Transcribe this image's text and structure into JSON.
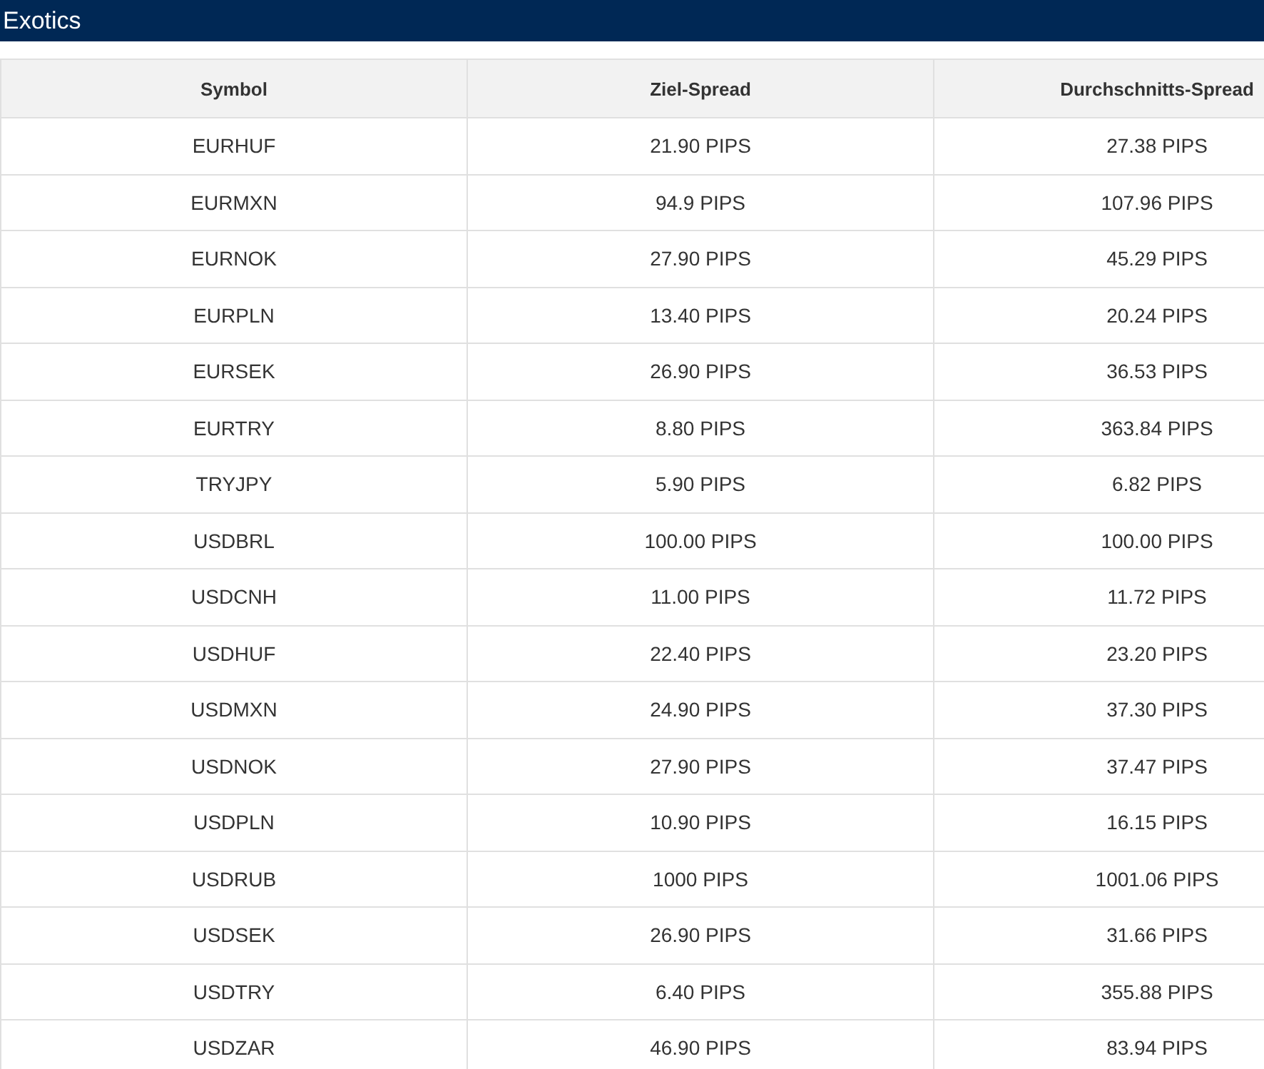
{
  "title": "Exotics",
  "table": {
    "columns": [
      "Symbol",
      "Ziel-Spread",
      "Durchschnitts-Spread"
    ],
    "rows": [
      [
        "EURHUF",
        "21.90 PIPS",
        "27.38 PIPS"
      ],
      [
        "EURMXN",
        "94.9 PIPS",
        "107.96 PIPS"
      ],
      [
        "EURNOK",
        "27.90 PIPS",
        "45.29 PIPS"
      ],
      [
        "EURPLN",
        "13.40 PIPS",
        "20.24 PIPS"
      ],
      [
        "EURSEK",
        "26.90 PIPS",
        "36.53 PIPS"
      ],
      [
        "EURTRY",
        "8.80 PIPS",
        "363.84 PIPS"
      ],
      [
        "TRYJPY",
        "5.90 PIPS",
        "6.82 PIPS"
      ],
      [
        "USDBRL",
        "100.00 PIPS",
        "100.00 PIPS"
      ],
      [
        "USDCNH",
        "11.00 PIPS",
        "11.72 PIPS"
      ],
      [
        "USDHUF",
        "22.40 PIPS",
        "23.20 PIPS"
      ],
      [
        "USDMXN",
        "24.90 PIPS",
        "37.30 PIPS"
      ],
      [
        "USDNOK",
        "27.90 PIPS",
        "37.47 PIPS"
      ],
      [
        "USDPLN",
        "10.90 PIPS",
        "16.15 PIPS"
      ],
      [
        "USDRUB",
        "1000 PIPS",
        "1001.06 PIPS"
      ],
      [
        "USDSEK",
        "26.90 PIPS",
        "31.66 PIPS"
      ],
      [
        "USDTRY",
        "6.40 PIPS",
        "355.88 PIPS"
      ],
      [
        "USDZAR",
        "46.90 PIPS",
        "83.94 PIPS"
      ]
    ]
  }
}
